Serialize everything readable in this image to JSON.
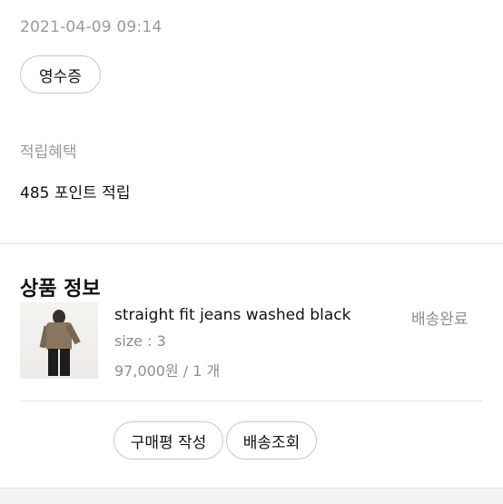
{
  "order": {
    "datetime": "2021-04-09 09:14",
    "receipt_label": "영수증"
  },
  "benefit": {
    "label": "적립혜택",
    "value": "485 포인트 적립"
  },
  "product_section": {
    "title": "상품 정보",
    "item": {
      "name": "straight fit jeans washed black",
      "status": "배송완료",
      "size": "size : 3",
      "price_qty": "97,000원 / 1 개"
    },
    "actions": {
      "write_review": "구매평 작성",
      "track_delivery": "배송조회"
    }
  }
}
